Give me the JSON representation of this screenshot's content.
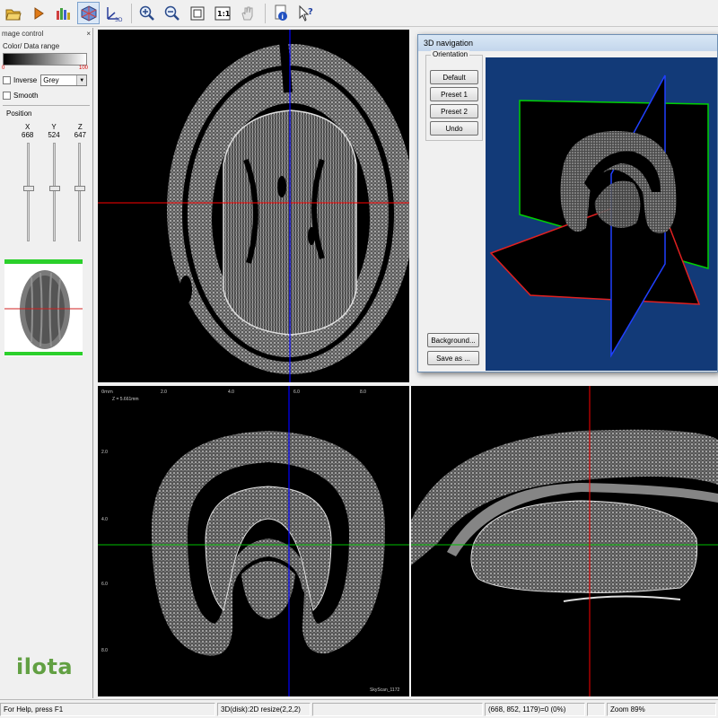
{
  "toolbar": {
    "buttons": [
      "open-icon",
      "play-icon",
      "color-histogram-icon",
      "3d-view-icon",
      "xyz-3d-icon",
      "zoom-in-icon",
      "zoom-out-icon",
      "fit-window-icon",
      "actual-size-icon",
      "pan-hand-icon",
      "info-icon",
      "whats-this-icon"
    ],
    "actual_size_label": "1:1",
    "xyz_label": "3D"
  },
  "left_panel": {
    "title": "mage control",
    "close": "×",
    "color_range_label": "Color/ Data range",
    "range_min": "0",
    "range_max": "100",
    "inverse_label": "Inverse",
    "colormap": "Grey",
    "smooth_label": "Smooth",
    "position_label": "Position",
    "axes": [
      {
        "name": "X",
        "value": "668"
      },
      {
        "name": "Y",
        "value": "524"
      },
      {
        "name": "Z",
        "value": "647"
      }
    ],
    "slider_levels": [
      0.5,
      0.5,
      0.5
    ],
    "logo": "ilota"
  },
  "dialog": {
    "title": "3D navigation",
    "orientation_label": "Orientation",
    "buttons": [
      "Default",
      "Preset 1",
      "Preset 2",
      "Undo"
    ],
    "background_button": "Background...",
    "saveas_button": "Save as ..."
  },
  "views": {
    "coronal_scale": {
      "unit": "0mm",
      "ticks_x": [
        "2.0",
        "4.0",
        "6.0",
        "8.0"
      ],
      "ticks_y": [
        "2.0",
        "4.0",
        "6.0",
        "8.0"
      ],
      "z_label": "Z = 5.661mm",
      "watermark": "SkyScan_1172"
    },
    "colors": {
      "red": "#ff0000",
      "green": "#00c000",
      "blue": "#0000ff"
    }
  },
  "statusbar": {
    "help": "For Help, press F1",
    "mode": "3D(disk):2D resize(2,2,2)",
    "coords": "(668, 852, 1179)=0 (0%)",
    "zoom": "Zoom 89%"
  }
}
